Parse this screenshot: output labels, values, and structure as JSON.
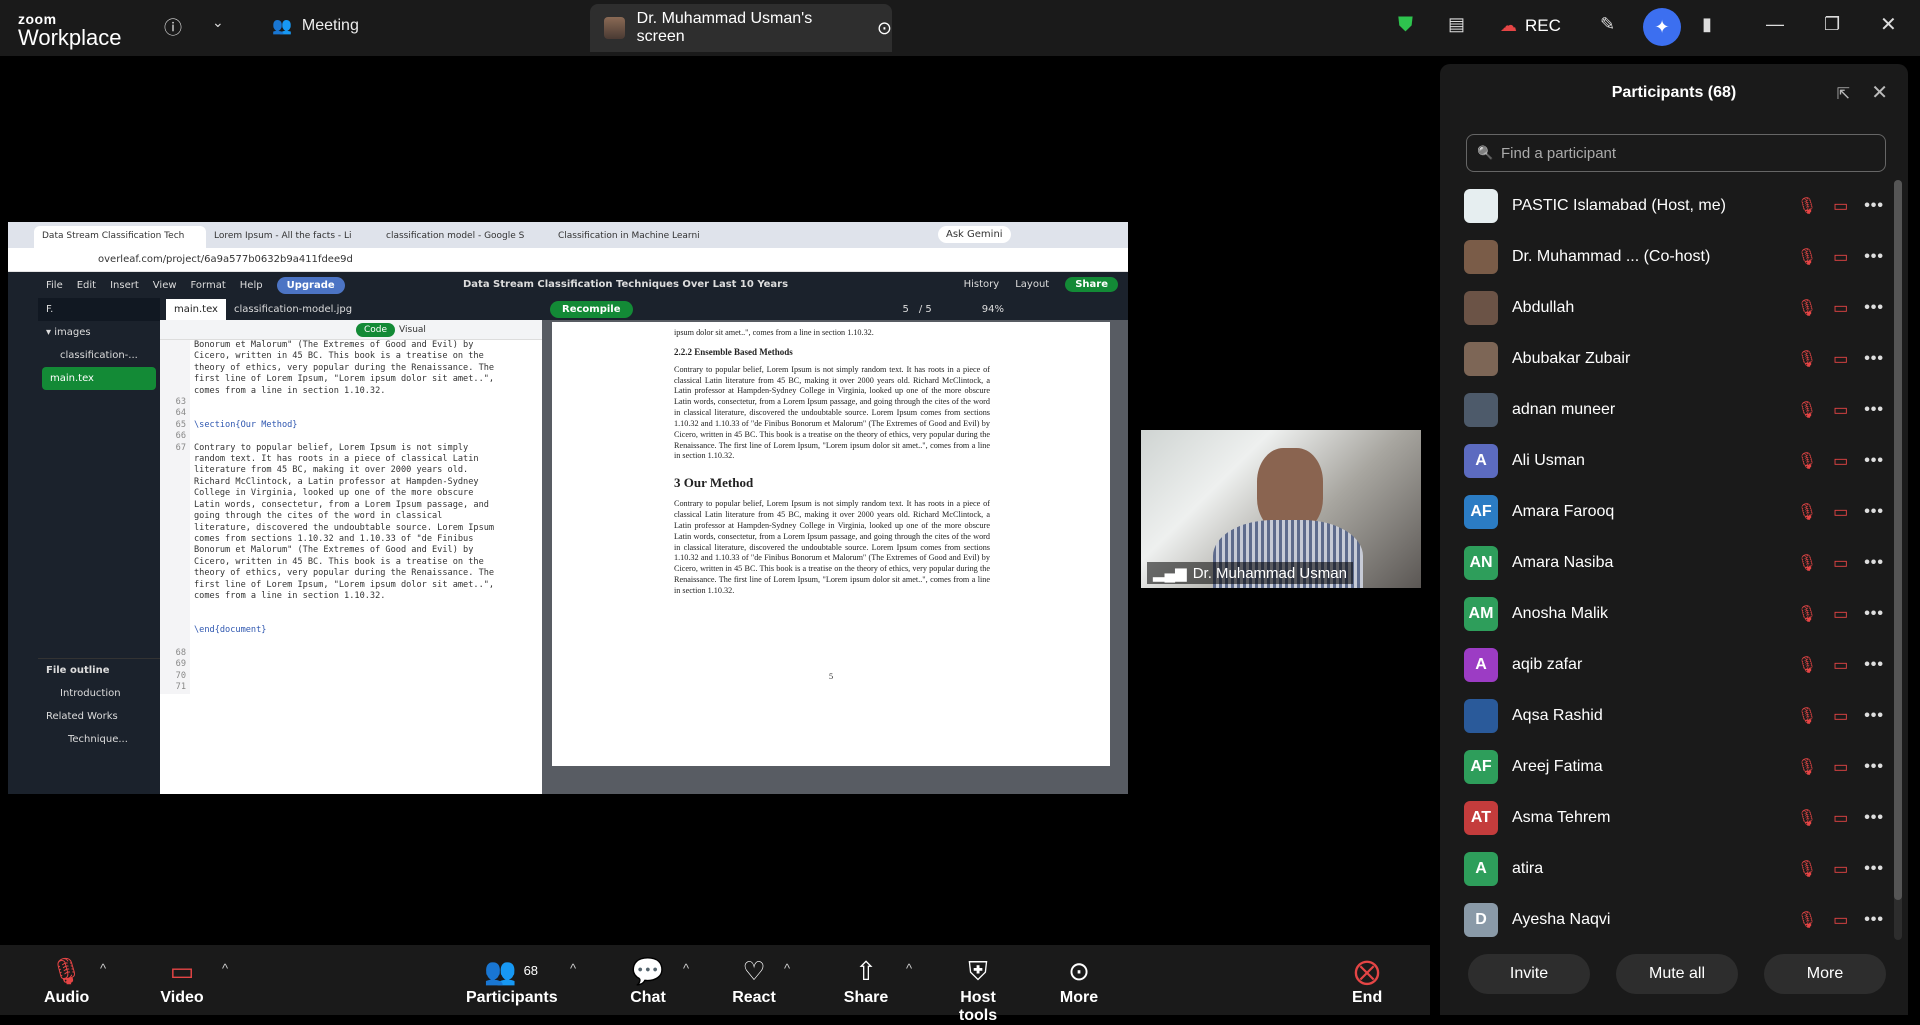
{
  "app": {
    "brand_top": "zoom",
    "brand_bottom": "Workplace"
  },
  "topbar": {
    "meeting_label": "Meeting",
    "screen_tab_label": "Dr. Muhammad Usman's screen",
    "rec_label": "REC"
  },
  "shared_screen": {
    "browser_tabs": [
      "Data Stream Classification Tech",
      "Lorem Ipsum - All the facts - Li",
      "classification model - Google S",
      "Classification in Machine Learni"
    ],
    "gemini_label": "Ask Gemini",
    "url": "overleaf.com/project/6a9a577b0632b9a411fdee9d",
    "menu": [
      "File",
      "Edit",
      "Insert",
      "View",
      "Format",
      "Help"
    ],
    "upgrade_label": "Upgrade",
    "doc_title": "Data Stream Classification Techniques Over Last 10 Years",
    "history_label": "History",
    "layout_label": "Layout",
    "share_label": "Share",
    "filetree": {
      "header": "F.",
      "folder": "images",
      "file1": "classification-...",
      "file2": "main.tex"
    },
    "outline": {
      "title": "File outline",
      "items": [
        "Introduction",
        "Related Works",
        "Technique..."
      ]
    },
    "editor_tabs": [
      "main.tex",
      "classification-model.jpg"
    ],
    "code_label": "Code",
    "visual_label": "Visual",
    "line_numbers": [
      "",
      "",
      "",
      "",
      "",
      "63",
      "64",
      "65",
      "66",
      "67",
      "",
      "",
      "",
      "",
      "",
      "",
      "",
      "",
      "",
      "",
      "",
      "",
      "",
      "",
      "",
      "",
      "",
      "68",
      "69",
      "70",
      "71"
    ],
    "code_lines": [
      "Bonorum et Malorum\" (The Extremes of Good and Evil) by",
      "Cicero, written in 45 BC. This book is a treatise on the",
      "theory of ethics, very popular during the Renaissance. The",
      "first line of Lorem Ipsum, \"Lorem ipsum dolor sit amet..\",",
      "comes from a line in section 1.10.32.",
      "",
      "",
      "\\section{Our Method}",
      "",
      "Contrary to popular belief, Lorem Ipsum is not simply",
      "random text. It has roots in a piece of classical Latin",
      "literature from 45 BC, making it over 2000 years old.",
      "Richard McClintock, a Latin professor at Hampden-Sydney",
      "College in Virginia, looked up one of the more obscure",
      "Latin words, consectetur, from a Lorem Ipsum passage, and",
      "going through the cites of the word in classical",
      "literature, discovered the undoubtable source. Lorem Ipsum",
      "comes from sections 1.10.32 and 1.10.33 of \"de Finibus",
      "Bonorum et Malorum\" (The Extremes of Good and Evil) by",
      "Cicero, written in 45 BC. This book is a treatise on the",
      "theory of ethics, very popular during the Renaissance. The",
      "first line of Lorem Ipsum, \"Lorem ipsum dolor sit amet..\",",
      "comes from a line in section 1.10.32.",
      "",
      "",
      "\\end{document}",
      ""
    ],
    "recompile_label": "Recompile",
    "page_current": "5",
    "page_total": "/ 5",
    "zoom_level": "94%",
    "pdf": {
      "top_fragment": "ipsum dolor sit amet..\", comes from a line in section 1.10.32.",
      "subsection": "2.2.2   Ensemble Based Methods",
      "para1": "Contrary to popular belief, Lorem Ipsum is not simply random text. It has roots in a piece of classical Latin literature from 45 BC, making it over 2000 years old. Richard McClintock, a Latin professor at Hampden-Sydney College in Virginia, looked up one of the more obscure Latin words, consectetur, from a Lorem Ipsum passage, and going through the cites of the word in classical literature, discovered the undoubtable source. Lorem Ipsum comes from sections 1.10.32 and 1.10.33 of \"de Finibus Bonorum et Malorum\" (The Extremes of Good and Evil) by Cicero, written in 45 BC. This book is a treatise on the theory of ethics, very popular during the Renaissance. The first line of Lorem Ipsum, \"Lorem ipsum dolor sit amet..\", comes from a line in section 1.10.32.",
      "section": "3   Our Method",
      "para2": "Contrary to popular belief, Lorem Ipsum is not simply random text. It has roots in a piece of classical Latin literature from 45 BC, making it over 2000 years old. Richard McClintock, a Latin professor at Hampden-Sydney College in Virginia, looked up one of the more obscure Latin words, consectetur, from a Lorem Ipsum passage, and going through the cites of the word in classical literature, discovered the undoubtable source. Lorem Ipsum comes from sections 1.10.32 and 1.10.33 of \"de Finibus Bonorum et Malorum\" (The Extremes of Good and Evil) by Cicero, written in 45 BC. This book is a treatise on the theory of ethics, very popular during the Renaissance. The first line of Lorem Ipsum, \"Lorem ipsum dolor sit amet..\", comes from a line in section 1.10.32.",
      "page_number": "5"
    }
  },
  "speaker": {
    "name": "Dr. Muhammad Usman"
  },
  "participants_panel": {
    "title": "Participants (68)",
    "search_placeholder": "Find a participant",
    "participants": [
      {
        "name": "PASTIC Islamabad (Host, me)",
        "avatar_type": "photo",
        "avatar_color": "#e6eef0"
      },
      {
        "name": "Dr. Muhammad ...  (Co-host)",
        "avatar_type": "photo",
        "avatar_color": "#7a5c48"
      },
      {
        "name": "Abdullah",
        "avatar_type": "photo",
        "avatar_color": "#6b5346"
      },
      {
        "name": "Abubakar Zubair",
        "avatar_type": "photo",
        "avatar_color": "#7d6656"
      },
      {
        "name": "adnan muneer",
        "avatar_type": "photo",
        "avatar_color": "#4d5a6a"
      },
      {
        "name": "Ali Usman",
        "avatar_type": "initials",
        "initials": "A",
        "avatar_color": "#5c6bc0"
      },
      {
        "name": "Amara Farooq",
        "avatar_type": "initials",
        "initials": "AF",
        "avatar_color": "#2b7cc4"
      },
      {
        "name": "Amara Nasiba",
        "avatar_type": "initials",
        "initials": "AN",
        "avatar_color": "#2e9e5b"
      },
      {
        "name": "Anosha Malik",
        "avatar_type": "initials",
        "initials": "AM",
        "avatar_color": "#2e9e5b"
      },
      {
        "name": "aqib zafar",
        "avatar_type": "initials",
        "initials": "A",
        "avatar_color": "#9c3cc4"
      },
      {
        "name": "Aqsa Rashid",
        "avatar_type": "photo",
        "avatar_color": "#2a5a9a"
      },
      {
        "name": "Areej Fatima",
        "avatar_type": "initials",
        "initials": "AF",
        "avatar_color": "#2e9e5b"
      },
      {
        "name": "Asma Tehrem",
        "avatar_type": "initials",
        "initials": "AT",
        "avatar_color": "#c43c3c"
      },
      {
        "name": "atira",
        "avatar_type": "initials",
        "initials": "A",
        "avatar_color": "#2e9e5b"
      },
      {
        "name": "Ayesha Naqvi",
        "avatar_type": "initials",
        "initials": "D",
        "avatar_color": "#8a9aa8"
      }
    ],
    "buttons": {
      "invite": "Invite",
      "mute_all": "Mute all",
      "more": "More"
    }
  },
  "bottombar": {
    "audio": "Audio",
    "video": "Video",
    "participants": "Participants",
    "participants_count": "68",
    "chat": "Chat",
    "react": "React",
    "share": "Share",
    "host_tools": "Host tools",
    "more": "More",
    "end": "End"
  },
  "colors": {
    "accent": "#3c6ff0",
    "danger": "#e54545",
    "overleaf_green": "#138a36",
    "bg": "#000000"
  }
}
